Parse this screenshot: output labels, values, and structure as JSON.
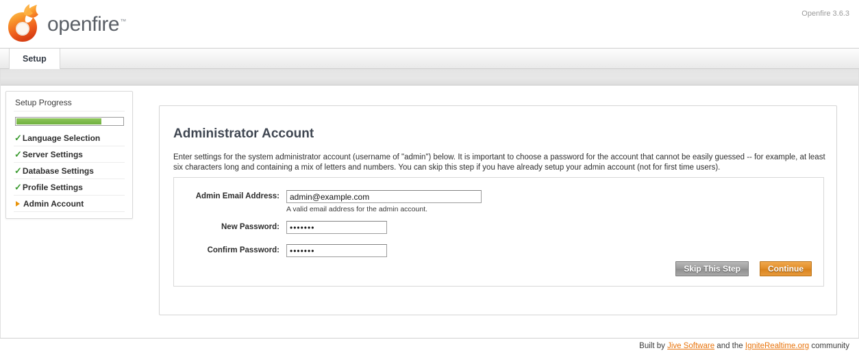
{
  "header": {
    "brand": "openfire",
    "trademark": "™",
    "logo_icon": "openfire-flame-logo",
    "version": "Openfire 3.6.3"
  },
  "tabs": [
    {
      "label": "Setup",
      "active": true
    }
  ],
  "sidebar": {
    "title": "Setup Progress",
    "progress_percent": 80,
    "progress_color": "#6faf3e",
    "items": [
      {
        "label": "Language Selection",
        "state": "done",
        "marker": "check-icon"
      },
      {
        "label": "Server Settings",
        "state": "done",
        "marker": "check-icon"
      },
      {
        "label": "Database Settings",
        "state": "done",
        "marker": "check-icon"
      },
      {
        "label": "Profile Settings",
        "state": "done",
        "marker": "check-icon"
      },
      {
        "label": "Admin Account",
        "state": "current",
        "marker": "arrow-right-icon"
      }
    ]
  },
  "main": {
    "title": "Administrator Account",
    "description": "Enter settings for the system administrator account (username of \"admin\") below. It is important to choose a password for the account that cannot be easily guessed -- for example, at least six characters long and containing a mix of letters and numbers. You can skip this step if you have already setup your admin account (not for first time users).",
    "form": {
      "email": {
        "label": "Admin Email Address:",
        "value": "admin@example.com",
        "placeholder": "",
        "help": "A valid email address for the admin account."
      },
      "new_password": {
        "label": "New Password:",
        "value": "•••••••",
        "placeholder": ""
      },
      "confirm_password": {
        "label": "Confirm Password:",
        "value": "•••••••",
        "placeholder": ""
      }
    },
    "buttons": {
      "skip": "Skip This Step",
      "continue": "Continue"
    }
  },
  "footer": {
    "prefix": "Built by ",
    "link1": "Jive Software",
    "middle": " and the ",
    "link2": "IgniteRealtime.org",
    "suffix": " community",
    "link_color": "#e8730a"
  }
}
